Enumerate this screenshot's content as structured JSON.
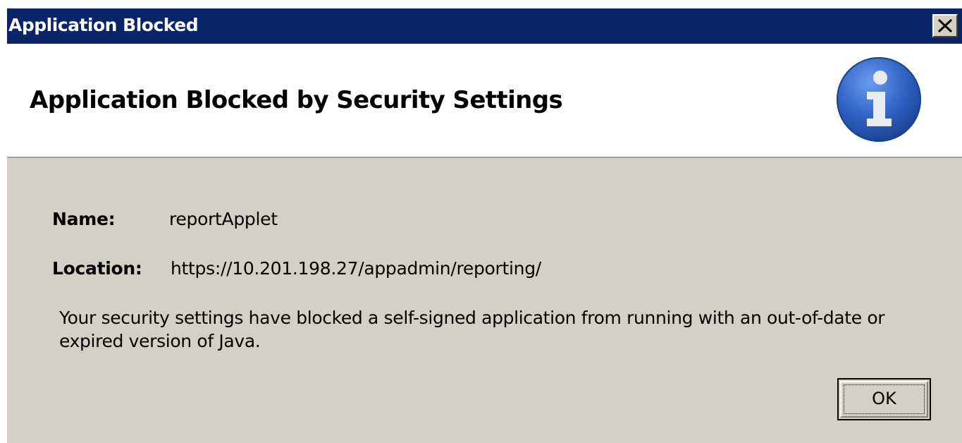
{
  "dialog": {
    "title": "Application Blocked",
    "heading": "Application Blocked by Security Settings",
    "icon": "info-icon",
    "fields": {
      "name_label": "Name:",
      "name_value": "reportApplet",
      "location_label": "Location:",
      "location_value": "https://10.201.198.27/appadmin/reporting/"
    },
    "message_line1": "Your security settings have blocked a self-signed application from running with an out-of-date or",
    "message_line2": "expired version of Java.",
    "ok_label": "OK",
    "close_icon": "close-icon"
  },
  "colors": {
    "titlebar": "#0a246a",
    "dialog_background": "#d4d0c8",
    "header_background": "#ffffff",
    "info_icon_blue": "#2f63c4"
  }
}
